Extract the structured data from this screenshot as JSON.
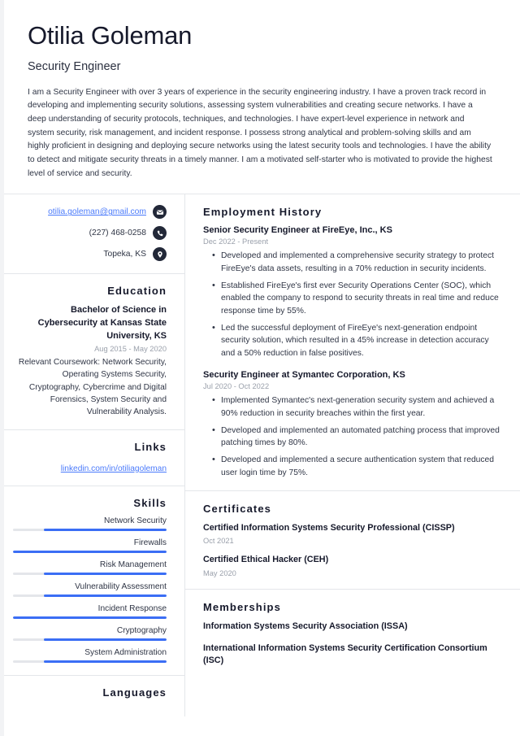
{
  "colors": {
    "accent_blue": "#3b6ef5",
    "link_blue": "#4a7afb",
    "heading_dark": "#16192b",
    "body_text": "#2f3545",
    "muted_date": "#9aa0ab",
    "divider": "#e4e6ea",
    "icon_circle": "#222838"
  },
  "header": {
    "name": "Otilia Goleman",
    "job_title": "Security Engineer",
    "summary": "I am a Security Engineer with over 3 years of experience in the security engineering industry. I have a proven track record in developing and implementing security solutions, assessing system vulnerabilities and creating secure networks. I have a deep understanding of security protocols, techniques, and technologies. I have expert-level experience in network and system security, risk management, and incident response. I possess strong analytical and problem-solving skills and am highly proficient in designing and deploying secure networks using the latest security tools and technologies. I have the ability to detect and mitigate security threats in a timely manner. I am a motivated self-starter who is motivated to provide the highest level of service and security."
  },
  "contact": {
    "email": "otilia.goleman@gmail.com",
    "email_icon": "envelope-icon",
    "phone": "(227) 468-0258",
    "phone_icon": "phone-icon",
    "location": "Topeka, KS",
    "location_icon": "location-pin-icon"
  },
  "education": {
    "title": "Education",
    "degree": "Bachelor of Science in Cybersecurity at Kansas State University, KS",
    "date": "Aug 2015 - May 2020",
    "description": "Relevant Coursework: Network Security, Operating Systems Security, Cryptography, Cybercrime and Digital Forensics, System Security and Vulnerability Analysis."
  },
  "links": {
    "title": "Links",
    "items": [
      {
        "label": "linkedin.com/in/otiliagoleman"
      }
    ]
  },
  "skills": {
    "title": "Skills",
    "items": [
      {
        "label": "Network Security",
        "level": 80
      },
      {
        "label": "Firewalls",
        "level": 100
      },
      {
        "label": "Risk Management",
        "level": 80
      },
      {
        "label": "Vulnerability Assessment",
        "level": 80
      },
      {
        "label": "Incident Response",
        "level": 100
      },
      {
        "label": "Cryptography",
        "level": 80
      },
      {
        "label": "System Administration",
        "level": 80
      }
    ]
  },
  "languages": {
    "title": "Languages"
  },
  "employment": {
    "title": "Employment History",
    "jobs": [
      {
        "role": "Senior Security Engineer at FireEye, Inc., KS",
        "date": "Dec 2022 - Present",
        "bullets": [
          "Developed and implemented a comprehensive security strategy to protect FireEye's data assets, resulting in a 70% reduction in security incidents.",
          "Established FireEye's first ever Security Operations Center (SOC), which enabled the company to respond to security threats in real time and reduce response time by 55%.",
          "Led the successful deployment of FireEye's next-generation endpoint security solution, which resulted in a 45% increase in detection accuracy and a 50% reduction in false positives."
        ]
      },
      {
        "role": "Security Engineer at Symantec Corporation, KS",
        "date": "Jul 2020 - Oct 2022",
        "bullets": [
          "Implemented Symantec's next-generation security system and achieved a 90% reduction in security breaches within the first year.",
          "Developed and implemented an automated patching process that improved patching times by 80%.",
          "Developed and implemented a secure authentication system that reduced user login time by 75%."
        ]
      }
    ]
  },
  "certificates": {
    "title": "Certificates",
    "items": [
      {
        "name": "Certified Information Systems Security Professional (CISSP)",
        "date": "Oct 2021"
      },
      {
        "name": "Certified Ethical Hacker (CEH)",
        "date": "May 2020"
      }
    ]
  },
  "memberships": {
    "title": "Memberships",
    "items": [
      {
        "name": "Information Systems Security Association (ISSA)"
      },
      {
        "name": "International Information Systems Security Certification Consortium (ISC)"
      }
    ]
  }
}
